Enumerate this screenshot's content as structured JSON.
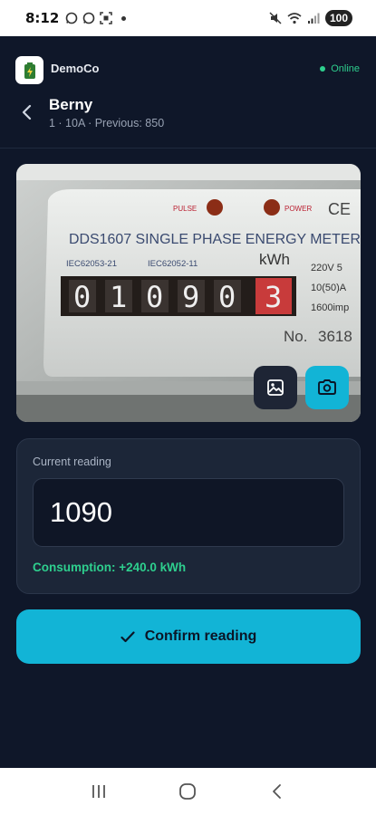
{
  "status_bar": {
    "time": "8:12",
    "battery": "100",
    "left_icons": [
      "whatsapp-icon",
      "whatsapp-icon",
      "screenshot-icon"
    ],
    "right_icons": [
      "mute-icon",
      "wifi-icon",
      "signal-icon"
    ]
  },
  "header": {
    "app_name": "DemoCo",
    "status": "Online",
    "meter_name": "Berny",
    "meter_subtitle": "1 · 10A · Previous: 850"
  },
  "photo": {
    "pulse_label": "PULSE",
    "power_label": "POWER",
    "model_text": "DDS1607 SINGLE PHASE ENERGY METER",
    "iec1": "IEC62053-21",
    "iec2": "IEC62052-11",
    "unit": "kWh",
    "spec1": "220V  5",
    "spec2": "10(50)A",
    "spec3": "1600imp",
    "no_label": "No.",
    "serial": "3618",
    "digits": [
      "0",
      "1",
      "0",
      "9",
      "0"
    ],
    "decimal_digit": "3",
    "ce_mark": "CE"
  },
  "reading_card": {
    "label": "Current reading",
    "value": "1090",
    "consumption": "Consumption: +240.0 kWh"
  },
  "confirm_button": {
    "label": "Confirm reading"
  },
  "colors": {
    "accent": "#12b4d6",
    "success": "#2ecf8e",
    "background": "#0f1729",
    "card": "#1c2638"
  }
}
